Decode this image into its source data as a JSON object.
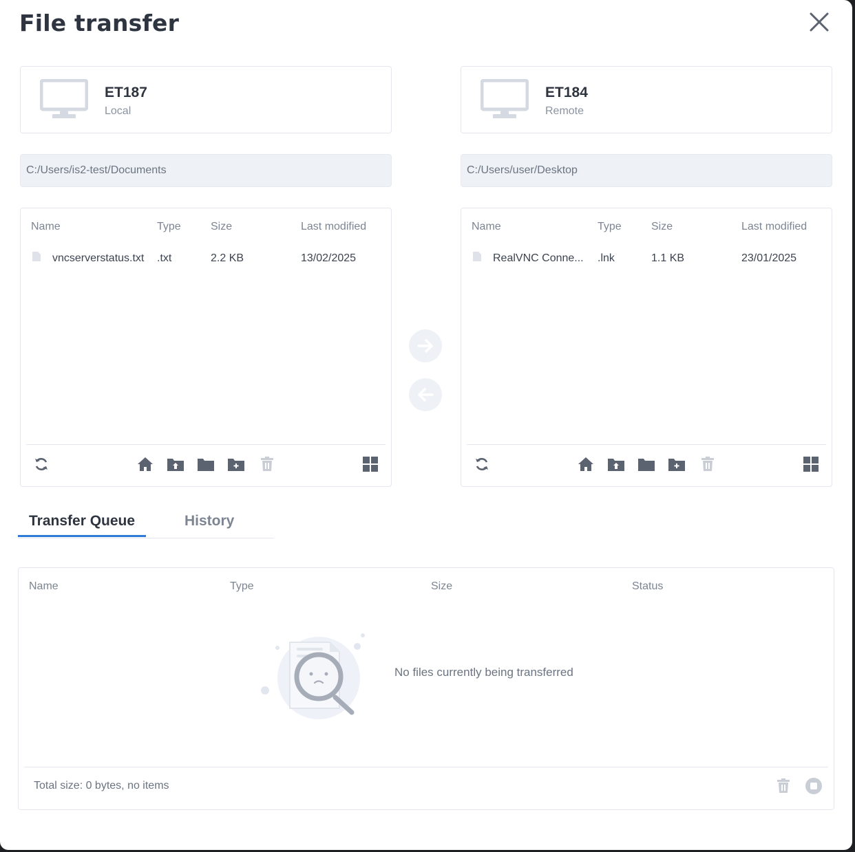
{
  "dialog": {
    "title": "File transfer"
  },
  "local": {
    "machine_name": "ET187",
    "machine_role": "Local",
    "path": "C:/Users/is2-test/Documents",
    "columns": {
      "name": "Name",
      "type": "Type",
      "size": "Size",
      "modified": "Last modified"
    },
    "files": [
      {
        "name": "vncserverstatus.txt",
        "type": ".txt",
        "size": "2.2 KB",
        "modified": "13/02/2025"
      }
    ]
  },
  "remote": {
    "machine_name": "ET184",
    "machine_role": "Remote",
    "path": "C:/Users/user/Desktop",
    "columns": {
      "name": "Name",
      "type": "Type",
      "size": "Size",
      "modified": "Last modified"
    },
    "files": [
      {
        "name": "RealVNC Conne...",
        "type": ".lnk",
        "size": "1.1 KB",
        "modified": "23/01/2025"
      }
    ]
  },
  "tabs": {
    "queue": "Transfer Queue",
    "history": "History"
  },
  "queue": {
    "columns": {
      "name": "Name",
      "type": "Type",
      "size": "Size",
      "status": "Status"
    },
    "empty_message": "No files currently being transferred",
    "total": "Total size: 0 bytes, no items"
  },
  "colors": {
    "accent": "#2f7ad6",
    "icon_dark": "#5b6370",
    "icon_disabled": "#c9ced6",
    "panel_border": "#e4e8ee"
  }
}
